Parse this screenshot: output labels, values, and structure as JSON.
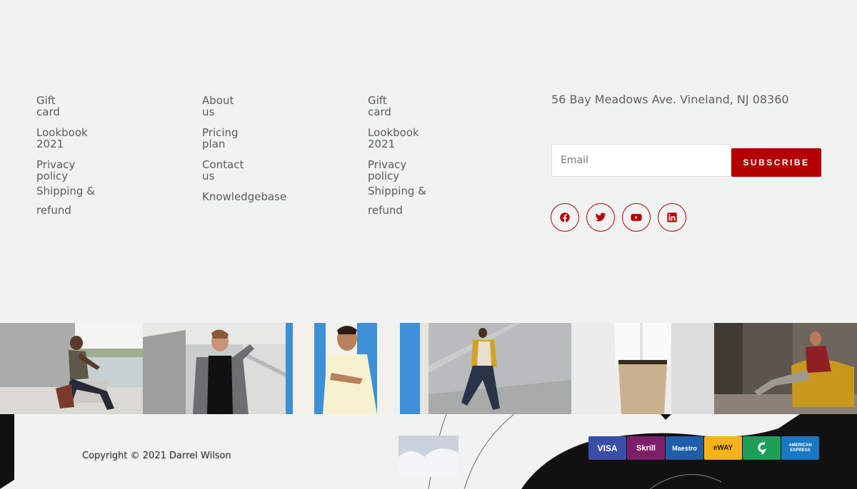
{
  "footer": {
    "columns": [
      {
        "links": [
          "Gift\ncard",
          "Lookbook\n2021",
          "Privacy\npolicy",
          "Shipping &\nrefund"
        ]
      },
      {
        "links": [
          "About\nus",
          "Pricing\nplan",
          "Contact\nus",
          "Knowledgebase"
        ]
      },
      {
        "links": [
          "Gift\ncard",
          "Lookbook\n2021",
          "Privacy\npolicy",
          "Shipping &\nrefund"
        ]
      }
    ],
    "address": "56 Bay Meadows Ave. Vineland, NJ 08360",
    "newsletter": {
      "email_placeholder": "Email",
      "subscribe_label": "SUBSCRIBE"
    },
    "social": [
      "facebook-icon",
      "twitter-icon",
      "youtube-icon",
      "linkedin-icon"
    ],
    "accent_color": "#b30000"
  },
  "bottom": {
    "copyright": "Copyright © 2021 Darrel Wilson",
    "payment_methods": [
      "VISA",
      "Skrill",
      "Maestro",
      "eWAY",
      "Sage",
      "AMERICAN EXPRESS"
    ]
  }
}
